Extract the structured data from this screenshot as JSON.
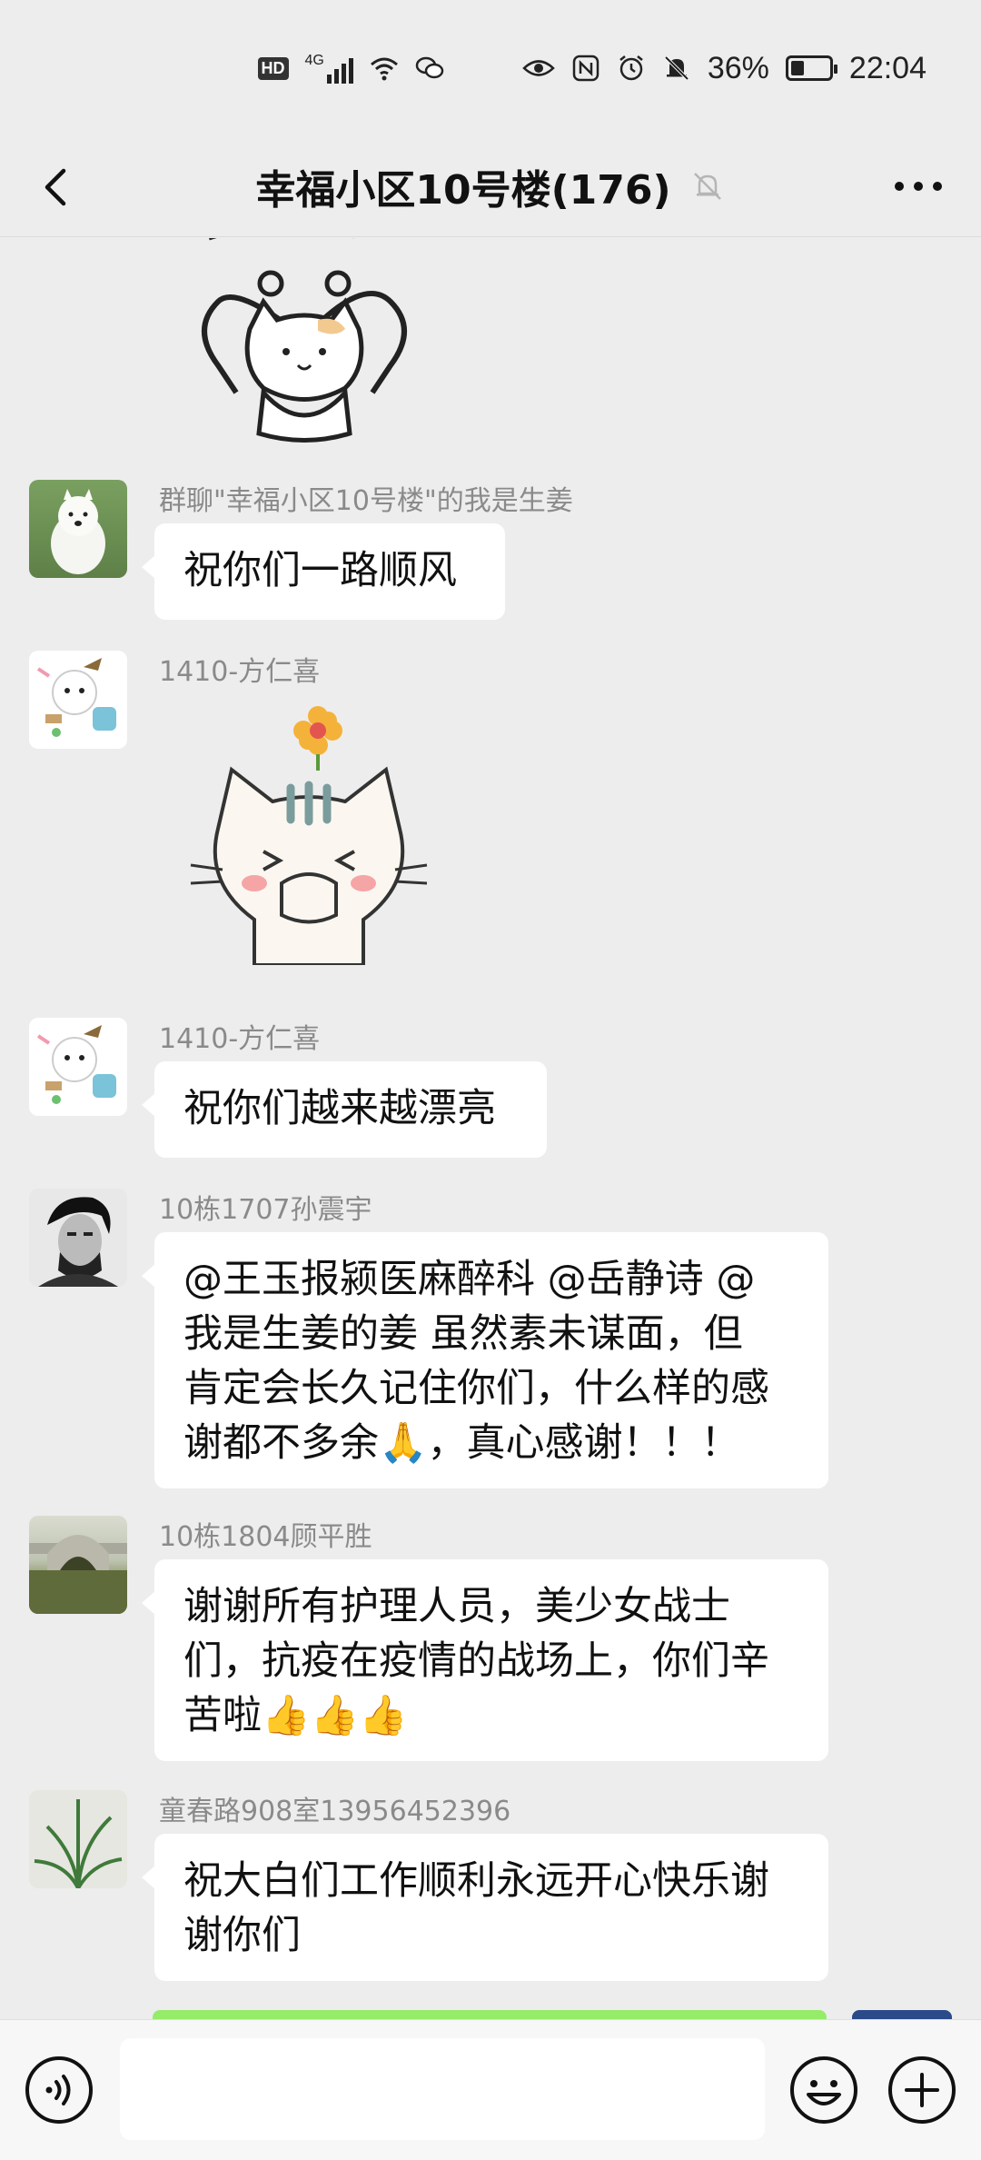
{
  "status_bar": {
    "hd": "HD",
    "network": "4G",
    "battery": "36%",
    "time": "22:04"
  },
  "header": {
    "title": "幸福小区10号楼(176)",
    "icons": {
      "back": "back-arrow-icon",
      "mute": "bell-muted-icon",
      "more": "more-dots-icon"
    }
  },
  "messages": [
    {
      "sender": "群聊\"幸福小区10号楼\"的我是生姜",
      "text": "祝你们一路顺风",
      "avatar": "white-dog-avatar"
    },
    {
      "sender": "1410-方仁喜",
      "sticker": "cat-flower-sticker",
      "avatar": "cartoon-sheep-avatar"
    },
    {
      "sender": "1410-方仁喜",
      "text": "祝你们越来越漂亮",
      "avatar": "cartoon-sheep-avatar"
    },
    {
      "sender": "10栋1707孙震宇",
      "lines": [
        "@王玉报颍医麻醉科  @岳静诗  @",
        "我是生姜的姜  虽然素未谋面，但",
        "肯定会长久记住你们，什么样的感",
        "谢都不多余🙏，真心感谢！！！"
      ],
      "avatar": "portrait-avatar"
    },
    {
      "sender": "10栋1804顾平胜",
      "lines": [
        "谢谢所有护理人员，美少女战士",
        "们，抗疫在疫情的战场上，你们辛",
        "苦啦👍👍👍"
      ],
      "avatar": "bridge-avatar"
    },
    {
      "sender": "童春路908室13956452396",
      "lines": [
        "祝大白们工作顺利永远开心快乐谢",
        "谢你们"
      ],
      "avatar": "plant-avatar"
    }
  ],
  "input_bar": {
    "placeholder": "",
    "icons": {
      "voice": "voice-icon",
      "emoji": "emoji-icon",
      "plus": "plus-icon"
    }
  }
}
